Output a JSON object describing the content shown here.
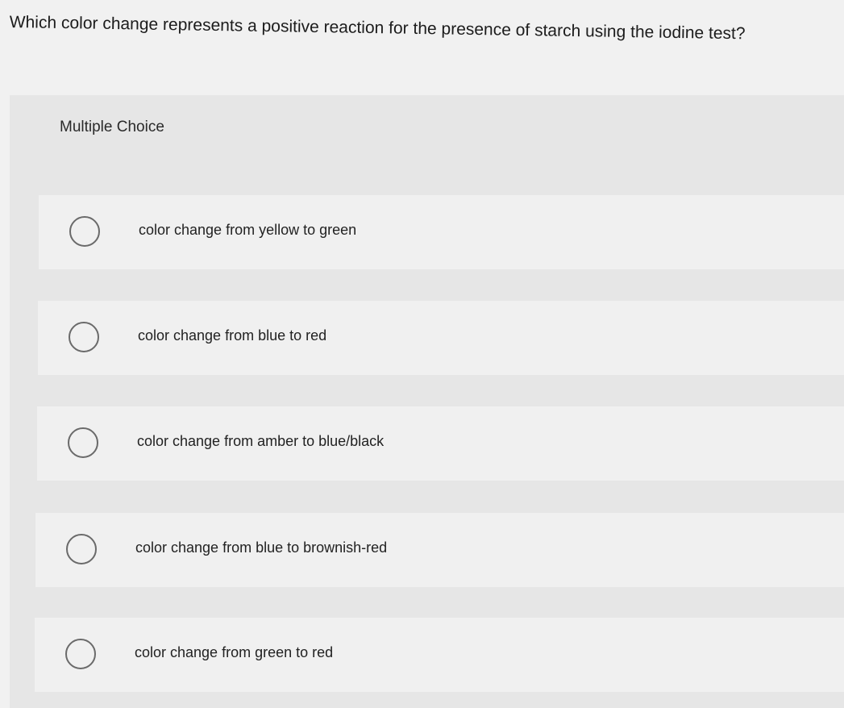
{
  "question": {
    "text": "Which color change represents a positive reaction for the presence of starch using the iodine test?"
  },
  "question_type": "Multiple Choice",
  "choices": [
    {
      "label": "color change from yellow to green"
    },
    {
      "label": "color change from blue to red"
    },
    {
      "label": "color change from amber to blue/black"
    },
    {
      "label": "color change from blue to brownish-red"
    },
    {
      "label": "color change from green to red"
    }
  ]
}
